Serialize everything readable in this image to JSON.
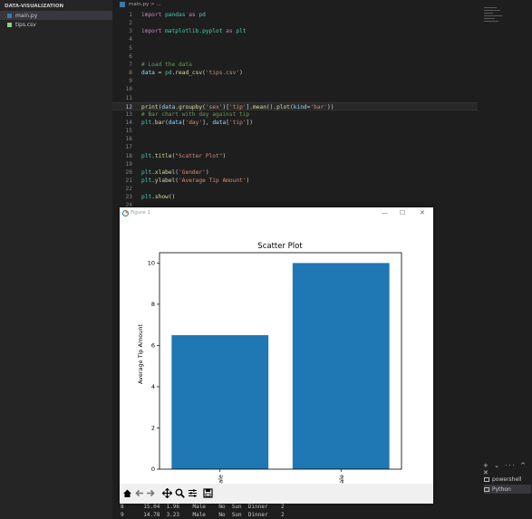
{
  "explorer": {
    "title": "DATA-VISUALIZATION",
    "files": [
      {
        "name": "main.py",
        "icon": "python-file-icon",
        "active": true
      },
      {
        "name": "tips.csv",
        "icon": "csv-file-icon",
        "active": false
      }
    ]
  },
  "editor": {
    "tab_label": "main.py  > ...",
    "current_line": 12,
    "lines": [
      {
        "n": "1",
        "html": "<span class='kw'>import</span> <span class='mod'>pandas</span> <span class='kw'>as</span> <span class='mod'>pd</span>"
      },
      {
        "n": "2",
        "html": ""
      },
      {
        "n": "3",
        "html": "<span class='kw'>import</span> <span class='mod'>matplotlib.pyplot</span> <span class='kw'>as</span> <span class='mod'>plt</span>"
      },
      {
        "n": "4",
        "html": ""
      },
      {
        "n": "5",
        "html": ""
      },
      {
        "n": "6",
        "html": ""
      },
      {
        "n": "7",
        "html": "<span class='cm'># Load the data</span>"
      },
      {
        "n": "8",
        "html": "<span class='nm'>data</span> = <span class='mod'>pd</span>.<span class='fn'>read_csv</span>(<span class='str'>'tips.csv'</span>)"
      },
      {
        "n": "9",
        "html": ""
      },
      {
        "n": "10",
        "html": ""
      },
      {
        "n": "11",
        "html": ""
      },
      {
        "n": "12",
        "html": "<span class='fn'>print</span>(<span class='nm'>data</span>.<span class='fn'>groupby</span>(<span class='str'>'sex'</span>)[<span class='str'>'tip'</span>].<span class='fn'>mean</span>().<span class='fn'>plot</span>(<span class='nm'>kind</span>=<span class='str'>'bar'</span>))"
      },
      {
        "n": "13",
        "html": "<span class='cm'># Bar chart with day against tip</span>"
      },
      {
        "n": "14",
        "html": "<span class='mod'>plt</span>.<span class='fn'>bar</span>(<span class='nm'>data</span>[<span class='str'>'day'</span>], <span class='nm'>data</span>[<span class='str'>'tip'</span>])"
      },
      {
        "n": "15",
        "html": ""
      },
      {
        "n": "16",
        "html": ""
      },
      {
        "n": "17",
        "html": ""
      },
      {
        "n": "18",
        "html": "<span class='mod'>plt</span>.<span class='fn'>title</span>(<span class='str'>\"Scatter Plot\"</span>)"
      },
      {
        "n": "19",
        "html": ""
      },
      {
        "n": "20",
        "html": "<span class='mod'>plt</span>.<span class='fn'>xlabel</span>(<span class='str'>'Gender'</span>)"
      },
      {
        "n": "21",
        "html": "<span class='mod'>plt</span>.<span class='fn'>ylabel</span>(<span class='str'>'Average Tip Amount'</span>)"
      },
      {
        "n": "22",
        "html": ""
      },
      {
        "n": "23",
        "html": "<span class='mod'>plt</span>.<span class='fn'>show</span>()"
      },
      {
        "n": "24",
        "html": ""
      }
    ]
  },
  "figure": {
    "window_title": "Figure 1",
    "minimize": "—",
    "maximize": "☐",
    "close": "✕"
  },
  "chart_data": {
    "type": "bar",
    "title": "Scatter Plot",
    "xlabel": "",
    "ylabel": "Average Tip Amount",
    "categories": [
      "Female",
      "Male"
    ],
    "values": [
      6.5,
      10
    ],
    "ylim": [
      0,
      10.5
    ],
    "yticks": [
      0,
      2,
      4,
      6,
      8,
      10
    ],
    "bar_color": "#1f77b4"
  },
  "terminal": {
    "rows": [
      "8      15.04  1.96    Male    No  Sun  Dinner    2",
      "9      14.78  3.23    Male    No  Sun  Dinner    2"
    ],
    "items": [
      {
        "label": "powershell",
        "active": false
      },
      {
        "label": "Python",
        "active": true
      }
    ],
    "toolbar": "+ ⌄ ··· ^ ✕"
  }
}
